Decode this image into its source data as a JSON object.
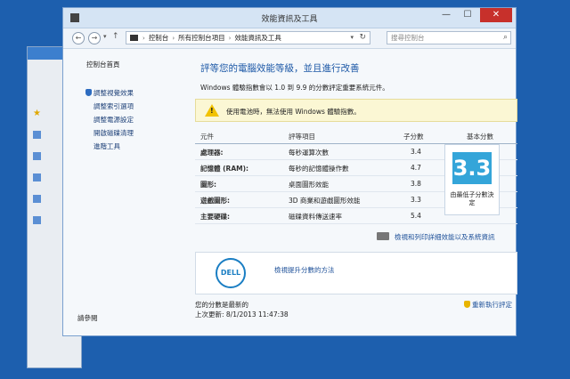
{
  "window": {
    "title": "效能資訊及工具"
  },
  "address_bar": {
    "breadcrumbs": [
      "控制台",
      "所有控制台項目",
      "效能資訊及工具"
    ],
    "search_placeholder": "搜尋控制台"
  },
  "sidebar": {
    "home": "控制台首頁",
    "items": [
      "調整視覺效果",
      "調整索引選項",
      "調整電源設定",
      "開啟磁碟清理",
      "進階工具"
    ],
    "see_also": "請參閱"
  },
  "main": {
    "heading": "評等您的電腦效能等級，並且進行改善",
    "subtitle": "Windows 體驗指數會以 1.0 到 9.9 的分數評定重要系統元件。",
    "warning": "使用電池時，無法使用 Windows 體驗指數。",
    "table": {
      "headers": [
        "元件",
        "評等項目",
        "子分數",
        "基本分數"
      ],
      "rows": [
        {
          "component": "處理器:",
          "item": "每秒運算次數",
          "score": "3.4"
        },
        {
          "component": "記憶體 (RAM):",
          "item": "每秒的記憶體操作數",
          "score": "4.7"
        },
        {
          "component": "圖形:",
          "item": "桌面圖形效能",
          "score": "3.8"
        },
        {
          "component": "遊戲圖形:",
          "item": "3D 商業和遊戲圖形效能",
          "score": "3.3"
        },
        {
          "component": "主要硬碟:",
          "item": "磁碟資料傳送速率",
          "score": "5.4"
        }
      ],
      "base_score": "3.3",
      "base_score_note_line1": "由最低子分數決",
      "base_score_note_line2": "定"
    },
    "printer_link": "檢視和列印詳細效能以及系統資訊",
    "dell_link": "檢視提升分數的方法",
    "dell_logo_text": "DELL",
    "status_line1": "您的分數是最新的",
    "status_line2": "上次更新: 8/1/2013 11:47:38",
    "rerun_label": "重新執行評定"
  },
  "icons": {
    "app": "control-panel-icon",
    "warning": "warning-icon",
    "shield": "shield-icon"
  },
  "colors": {
    "accent": "#1b57a6",
    "score_tile": "#34a5d9",
    "close_button": "#c7302b",
    "warning_bg": "#fbf7d4"
  }
}
